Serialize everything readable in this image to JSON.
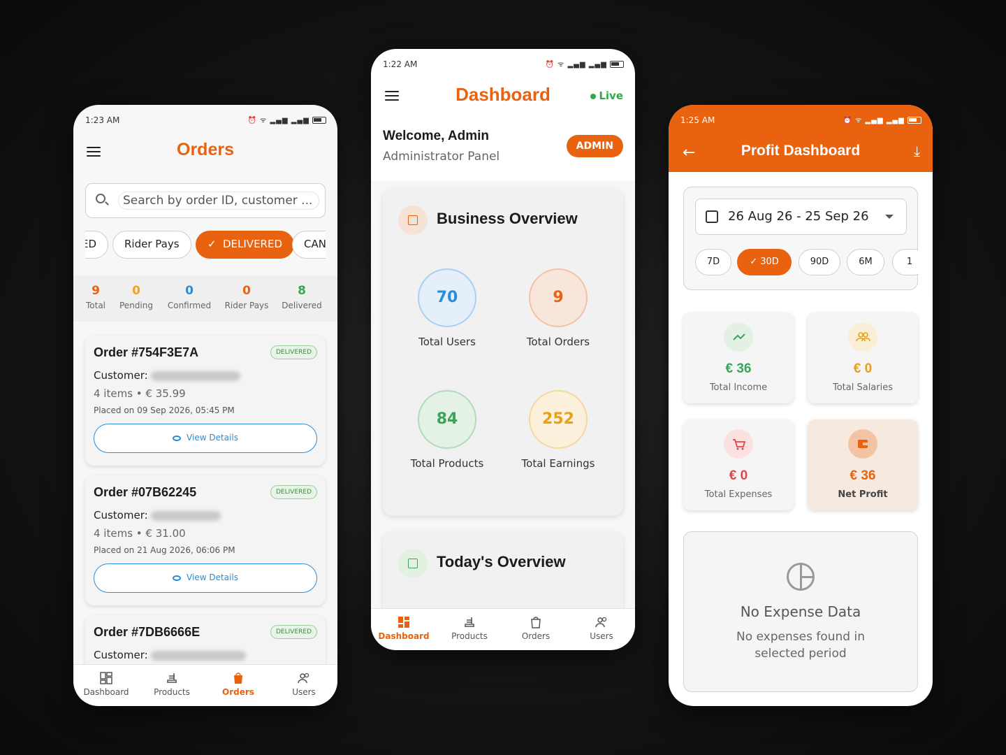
{
  "orders_phone": {
    "status": {
      "time": "1:23 AM"
    },
    "title": "Orders",
    "search": {
      "placeholder": "Search by order ID, customer ..."
    },
    "filters": [
      {
        "label": "ED"
      },
      {
        "label": "Rider Pays"
      },
      {
        "label": "DELIVERED",
        "active": true
      },
      {
        "label": "CAN"
      }
    ],
    "stats": [
      {
        "num": "9",
        "label": "Total",
        "color": "#e8620f"
      },
      {
        "num": "0",
        "label": "Pending",
        "color": "#f0a31c"
      },
      {
        "num": "0",
        "label": "Confirmed",
        "color": "#2a8dd8"
      },
      {
        "num": "0",
        "label": "Rider Pays",
        "color": "#e8620f"
      },
      {
        "num": "8",
        "label": "Delivered",
        "color": "#3ca35a"
      }
    ],
    "orders": [
      {
        "id": "Order #754F3E7A",
        "status": "DELIVERED",
        "customer_label": "Customer:",
        "items": "4 items • € 35.99",
        "placed": "Placed on 09 Sep 2026, 05:45 PM",
        "view": "View Details"
      },
      {
        "id": "Order #07B62245",
        "status": "DELIVERED",
        "customer_label": "Customer:",
        "items": "4 items • € 31.00",
        "placed": "Placed on 21 Aug 2026, 06:06 PM",
        "view": "View Details"
      },
      {
        "id": "Order #7DB6666E",
        "status": "DELIVERED",
        "customer_label": "Customer:"
      }
    ],
    "nav": [
      {
        "label": "Dashboard",
        "icon": "dashboard-icon"
      },
      {
        "label": "Products",
        "icon": "products-icon"
      },
      {
        "label": "Orders",
        "icon": "orders-icon",
        "active": true
      },
      {
        "label": "Users",
        "icon": "users-icon"
      }
    ]
  },
  "dashboard_phone": {
    "status": {
      "time": "1:22 AM"
    },
    "title": "Dashboard",
    "live": "Live",
    "welcome": "Welcome, Admin",
    "subtitle": "Administrator Panel",
    "role_badge": "ADMIN",
    "business_overview": {
      "title": "Business Overview",
      "stats": [
        {
          "value": "70",
          "label": "Total Users",
          "color": "#2a8dd8",
          "bg": "#e4eff9"
        },
        {
          "value": "9",
          "label": "Total Orders",
          "color": "#e8620f",
          "bg": "#f8e6dc"
        },
        {
          "value": "84",
          "label": "Total Products",
          "color": "#3ca35a",
          "bg": "#e4f1e5"
        },
        {
          "value": "252",
          "label": "Total Earnings",
          "color": "#e8a017",
          "bg": "#faf0dc"
        }
      ]
    },
    "todays_overview": {
      "title": "Today's Overview"
    },
    "nav": [
      {
        "label": "Dashboard",
        "icon": "dashboard-icon",
        "active": true
      },
      {
        "label": "Products",
        "icon": "products-icon"
      },
      {
        "label": "Orders",
        "icon": "orders-icon"
      },
      {
        "label": "Users",
        "icon": "users-icon"
      }
    ]
  },
  "profit_phone": {
    "status": {
      "time": "1:25 AM"
    },
    "title": "Profit Dashboard",
    "date_range": "26 Aug 26 - 25 Sep 26",
    "ranges": [
      {
        "label": "7D"
      },
      {
        "label": "30D",
        "active": true
      },
      {
        "label": "90D"
      },
      {
        "label": "6M"
      },
      {
        "label": "1"
      }
    ],
    "metrics": [
      {
        "value": "€ 36",
        "label": "Total Income",
        "color": "#3ca35a",
        "icon": "trending-up-icon"
      },
      {
        "value": "€ 0",
        "label": "Total Salaries",
        "color": "#e8a017",
        "icon": "people-icon"
      },
      {
        "value": "€ 0",
        "label": "Total Expenses",
        "color": "#e04848",
        "icon": "cart-icon"
      },
      {
        "value": "€ 36",
        "label": "Net Profit",
        "color": "#e8620f",
        "icon": "wallet-icon"
      }
    ],
    "empty": {
      "title": "No Expense Data",
      "desc": "No expenses found in selected period"
    }
  }
}
